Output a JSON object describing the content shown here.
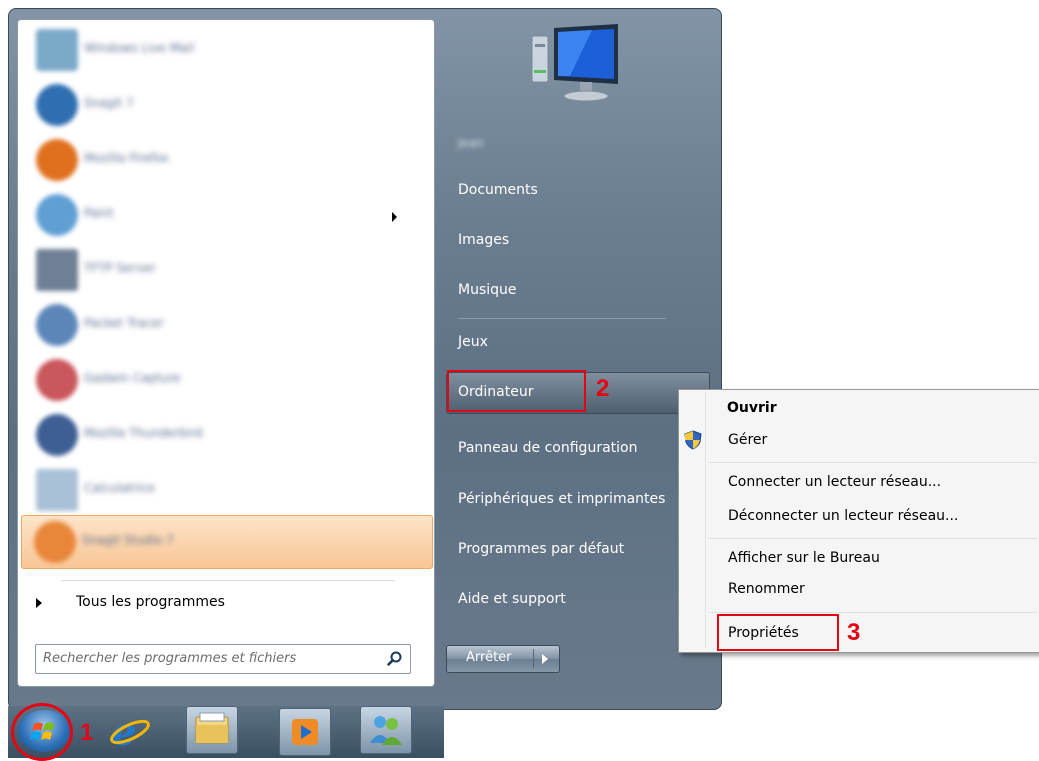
{
  "start_menu": {
    "pinned_programs": [
      {
        "label": "Windows Live Mail",
        "icon": "mail-app-icon",
        "color": "#7aa9c9"
      },
      {
        "label": "Snagit 7",
        "icon": "snagit-icon",
        "color": "#2f6eb0"
      },
      {
        "label": "Mozilla Firefox",
        "icon": "firefox-icon",
        "color": "#e0701e"
      },
      {
        "label": "Paint",
        "icon": "paint-icon",
        "color": "#5f9fd3"
      },
      {
        "label": "TFTP Server",
        "icon": "server-app-icon",
        "color": "#6f7f95"
      },
      {
        "label": "Packet Tracer",
        "icon": "network-app-icon",
        "color": "#5c86b8"
      },
      {
        "label": "Gadwin Capture",
        "icon": "capture-app-icon",
        "color": "#c9575c"
      },
      {
        "label": "Mozilla Thunderbird",
        "icon": "thunderbird-icon",
        "color": "#3e5f93"
      },
      {
        "label": "Calculatrice",
        "icon": "calculator-icon",
        "color": "#a9c1d6"
      },
      {
        "label": "Snagit Studio 7",
        "icon": "snagit-studio-icon",
        "color": "#e8863a"
      }
    ],
    "all_programs_label": "Tous les programmes",
    "search_placeholder": "Rechercher les programmes et fichiers",
    "user_name": "Jean",
    "right_items": {
      "documents": "Documents",
      "images": "Images",
      "music": "Musique",
      "games": "Jeux",
      "computer": "Ordinateur",
      "control_panel": "Panneau de configuration",
      "devices": "Périphériques et imprimantes",
      "default_programs": "Programmes par défaut",
      "help": "Aide et support"
    },
    "shutdown_label": "Arrêter"
  },
  "context_menu": {
    "open": "Ouvrir",
    "manage": "Gérer",
    "map_drive": "Connecter un lecteur réseau...",
    "disconnect_drive": "Déconnecter un lecteur réseau...",
    "show_desktop": "Afficher sur le Bureau",
    "rename": "Renommer",
    "properties": "Propriétés"
  },
  "annotations": {
    "step1": "1",
    "step2": "2",
    "step3": "3"
  },
  "colors": {
    "annotation_red": "#e30613",
    "highlight": "#fbd3a6"
  }
}
